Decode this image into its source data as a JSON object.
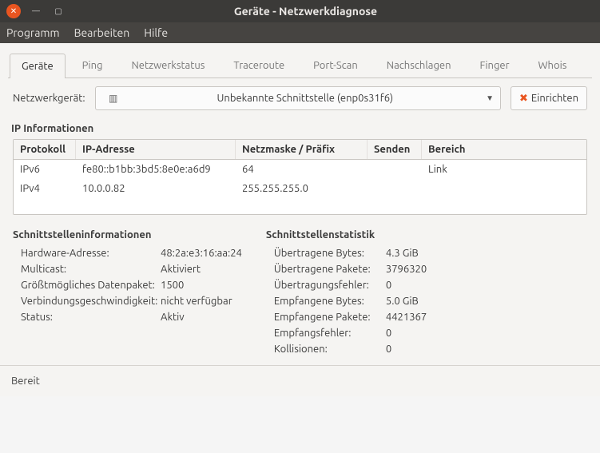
{
  "window": {
    "title": "Geräte - Netzwerkdiagnose"
  },
  "menu": {
    "program": "Programm",
    "edit": "Bearbeiten",
    "help": "Hilfe"
  },
  "tabs": {
    "devices": "Geräte",
    "ping": "Ping",
    "netstatus": "Netzwerkstatus",
    "traceroute": "Traceroute",
    "portscan": "Port-Scan",
    "lookup": "Nachschlagen",
    "finger": "Finger",
    "whois": "Whois"
  },
  "device": {
    "label": "Netzwerkgerät:",
    "selected": "Unbekannte Schnittstelle (enp0s31f6)",
    "configure": "Einrichten"
  },
  "ip": {
    "title": "IP Informationen",
    "headers": {
      "proto": "Protokoll",
      "addr": "IP-Adresse",
      "mask": "Netzmaske / Präfix",
      "send": "Senden",
      "scope": "Bereich"
    },
    "rows": [
      {
        "proto": "IPv6",
        "addr": "fe80::b1bb:3bd5:8e0e:a6d9",
        "mask": "64",
        "send": "",
        "scope": "Link"
      },
      {
        "proto": "IPv4",
        "addr": "10.0.0.82",
        "mask": "255.255.255.0",
        "send": "",
        "scope": ""
      }
    ]
  },
  "ifinfo": {
    "title": "Schnittstelleninformationen",
    "items": {
      "hw_k": "Hardware-Adresse:",
      "hw_v": "48:2a:e3:16:aa:24",
      "mc_k": "Multicast:",
      "mc_v": "Aktiviert",
      "mtu_k": "Größtmögliches Datenpaket:",
      "mtu_v": "1500",
      "speed_k": "Verbindungsgeschwindigkeit:",
      "speed_v": "nicht verfügbar",
      "status_k": "Status:",
      "status_v": "Aktiv"
    }
  },
  "ifstat": {
    "title": "Schnittstellenstatistik",
    "items": {
      "txb_k": "Übertragene Bytes:",
      "txb_v": "4.3 GiB",
      "txp_k": "Übertragene Pakete:",
      "txp_v": "3796320",
      "txe_k": "Übertragungsfehler:",
      "txe_v": "0",
      "rxb_k": "Empfangene Bytes:",
      "rxb_v": "5.0 GiB",
      "rxp_k": "Empfangene Pakete:",
      "rxp_v": "4421367",
      "rxe_k": "Empfangsfehler:",
      "rxe_v": "0",
      "col_k": "Kollisionen:",
      "col_v": "0"
    }
  },
  "status": "Bereit"
}
